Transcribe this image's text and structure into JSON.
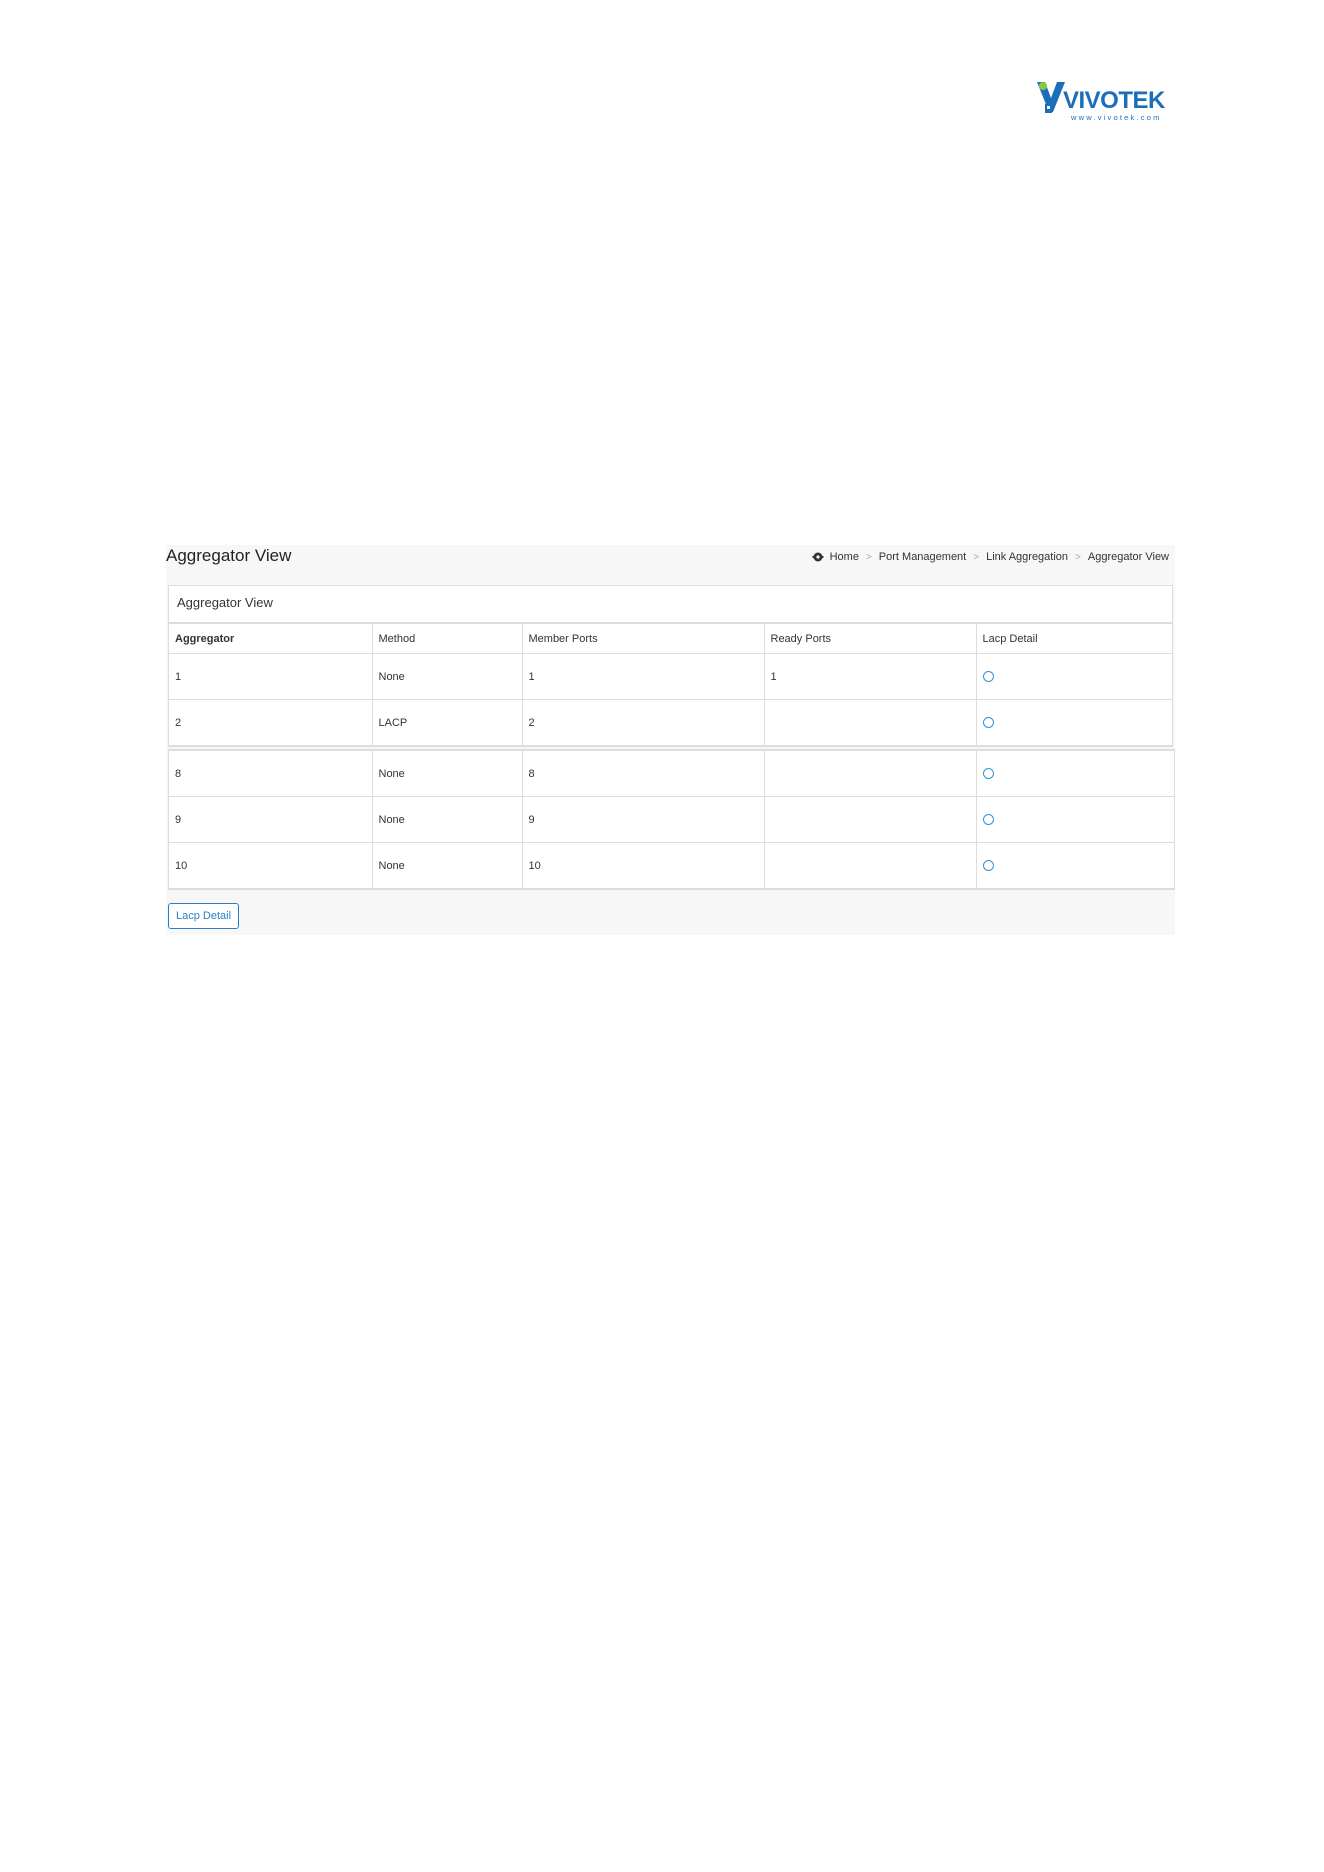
{
  "logo": {
    "brand": "VIVOTEK",
    "url_text": "www.vivotek.com"
  },
  "page": {
    "title": "Aggregator View"
  },
  "breadcrumb": {
    "home_icon": "home-icon",
    "items": [
      "Home",
      "Port Management",
      "Link Aggregation",
      "Aggregator View"
    ],
    "separator": ">"
  },
  "panel": {
    "header": "Aggregator View",
    "columns": [
      "Aggregator",
      "Method",
      "Member Ports",
      "Ready Ports",
      "Lacp Detail"
    ],
    "rows": [
      {
        "aggregator": "1",
        "method": "None",
        "member_ports": "1",
        "ready_ports": "1",
        "lacp_selected": false
      },
      {
        "aggregator": "2",
        "method": "LACP",
        "member_ports": "2",
        "ready_ports": "",
        "lacp_selected": false
      }
    ],
    "rows_extra": [
      {
        "aggregator": "8",
        "method": "None",
        "member_ports": "8",
        "ready_ports": "",
        "lacp_selected": false
      },
      {
        "aggregator": "9",
        "method": "None",
        "member_ports": "9",
        "ready_ports": "",
        "lacp_selected": false
      },
      {
        "aggregator": "10",
        "method": "None",
        "member_ports": "10",
        "ready_ports": "",
        "lacp_selected": false
      }
    ]
  },
  "buttons": {
    "lacp_detail": "Lacp Detail"
  },
  "colors": {
    "accent": "#2a7fc4",
    "logo_blue": "#1a6fb8",
    "logo_green": "#8cc63f"
  }
}
